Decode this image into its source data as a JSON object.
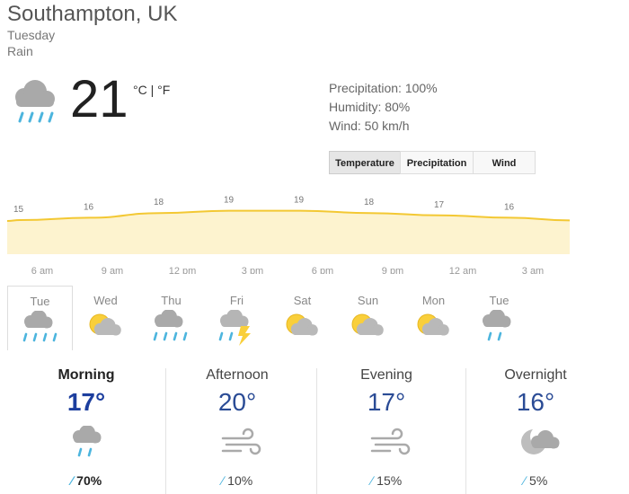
{
  "header": {
    "location": "Southampton, UK",
    "day": "Tuesday",
    "condition": "Rain"
  },
  "current": {
    "icon": "rain-cloud-icon",
    "temperature": "21",
    "unit_c": "°C",
    "unit_sep": " | ",
    "unit_f": "°F",
    "precipitation": "Precipitation: 100%",
    "humidity": "Humidity: 80%",
    "wind": "Wind: 50 km/h"
  },
  "tabs": [
    "Temperature",
    "Precipitation",
    "Wind"
  ],
  "active_tab": "Temperature",
  "chart_data": {
    "type": "area",
    "x_labels": [
      "6 am",
      "9 am",
      "12 pm",
      "3 pm",
      "6 pm",
      "9 pm",
      "12 am",
      "3 am"
    ],
    "values": [
      15,
      16,
      18,
      19,
      19,
      18,
      17,
      16
    ],
    "fill_color": "#fdf3cf",
    "line_color": "#f3c833",
    "label_color": "#777777"
  },
  "forecast": [
    {
      "day": "Tue",
      "icon": "rain-icon",
      "selected": true
    },
    {
      "day": "Wed",
      "icon": "partly-sunny-icon",
      "selected": false
    },
    {
      "day": "Thu",
      "icon": "rain-icon",
      "selected": false
    },
    {
      "day": "Fri",
      "icon": "thunderstorm-icon",
      "selected": false
    },
    {
      "day": "Sat",
      "icon": "partly-sunny-icon",
      "selected": false
    },
    {
      "day": "Sun",
      "icon": "partly-sunny-icon",
      "selected": false
    },
    {
      "day": "Mon",
      "icon": "partly-sunny-icon",
      "selected": false
    },
    {
      "day": "Tue",
      "icon": "light-rain-icon",
      "selected": false
    }
  ],
  "periods": [
    {
      "name": "Morning",
      "temp": "17°",
      "icon": "light-rain-icon",
      "precip": "70%",
      "bold": true
    },
    {
      "name": "Afternoon",
      "temp": "20°",
      "icon": "wind-icon",
      "precip": "10%",
      "bold": false
    },
    {
      "name": "Evening",
      "temp": "17°",
      "icon": "wind-icon",
      "precip": "15%",
      "bold": false
    },
    {
      "name": "Overnight",
      "temp": "16°",
      "icon": "cloudy-night-icon",
      "precip": "5%",
      "bold": false
    }
  ],
  "colors": {
    "rain_drop": "#4db5de",
    "cloud": "#a9a9a9",
    "sun": "#f9cf3b",
    "temp_blue": "#2a4b95"
  }
}
